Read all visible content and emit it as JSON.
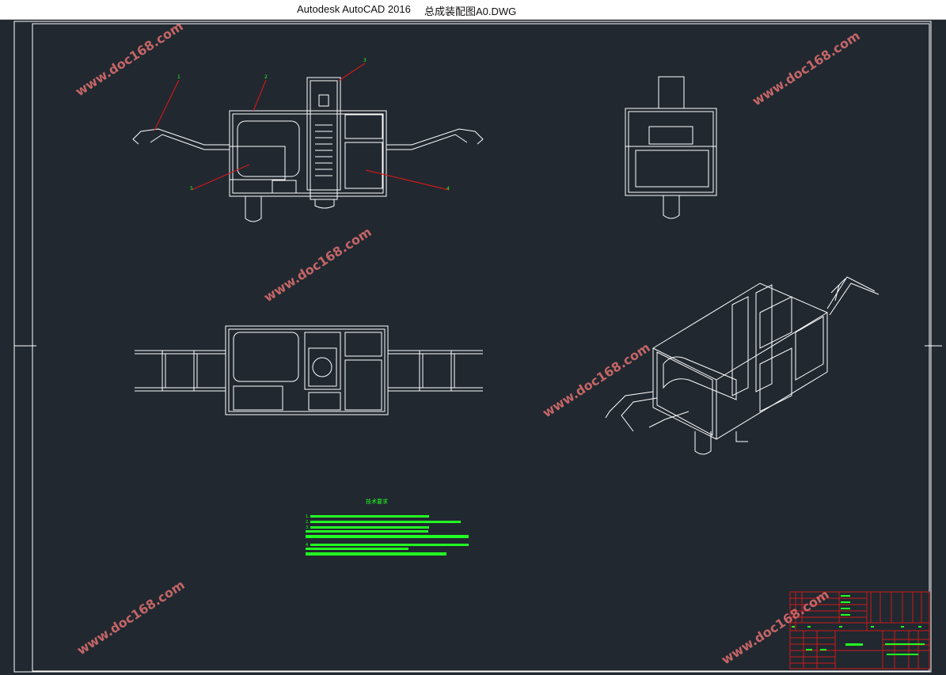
{
  "window": {
    "app_title": "Autodesk AutoCAD 2016",
    "document_title": "总成装配图A0.DWG"
  },
  "watermark": {
    "text": "www.doc168.com"
  },
  "drawing": {
    "colors": {
      "background": "#212830",
      "lines": "#ffffff",
      "leader": "#cc1a1a",
      "notes": "#22ff22",
      "title_block": "#cc1a1a"
    },
    "balloons": [
      "1",
      "2",
      "3",
      "4",
      "5"
    ],
    "technical_requirements": {
      "heading": "技术要求",
      "item_numbers": [
        "1.",
        "2.",
        "3.",
        "4."
      ]
    },
    "views": [
      "front-view",
      "side-view",
      "top-view",
      "isometric-view"
    ]
  }
}
